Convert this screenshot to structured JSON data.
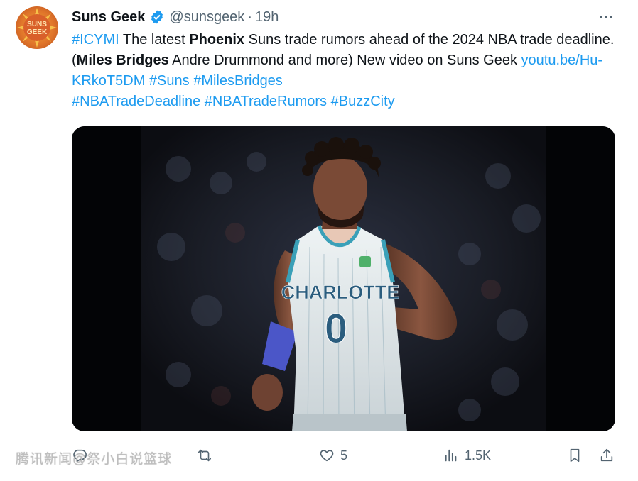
{
  "author": {
    "name": "Suns Geek",
    "handle": "@sunsgeek",
    "separator": "·",
    "time": "19h",
    "avatar_text_top": "SUNS",
    "avatar_text_bottom": "GEEK"
  },
  "tweet": {
    "t1": "#ICYMI",
    "t2": " The latest ",
    "t3": "Phoenix",
    "t4": " Suns trade rumors ahead of the 2024 NBA trade deadline. (",
    "t5": "Miles Bridges",
    "t6": " Andre Drummond and more) New video on Suns Geek ",
    "t7": "youtu.be/Hu-KRkoT5DM",
    "t8": " ",
    "t9": "#Suns",
    "t10": " ",
    "t11": "#MilesBridges",
    "t12": "#NBATradeDeadline",
    "t13": " ",
    "t14": "#NBATradeRumors",
    "t15": " ",
    "t16": "#BuzzCity"
  },
  "media": {
    "jersey_team": "CHARLOTTE",
    "jersey_number": "0"
  },
  "actions": {
    "likes": "5",
    "views": "1.5K"
  },
  "watermark": "腾讯新闻@祭小白说篮球",
  "colors": {
    "link": "#1d9bf0",
    "muted": "#536471",
    "verified": "#1d9bf0",
    "avatar": "#e0752a"
  },
  "icons": {
    "verified": "verified-badge-icon",
    "more": "more-dots-icon",
    "reply": "reply-icon",
    "retweet": "retweet-icon",
    "like": "heart-icon",
    "views": "views-bar-icon",
    "bookmark": "bookmark-icon",
    "share": "share-icon"
  }
}
